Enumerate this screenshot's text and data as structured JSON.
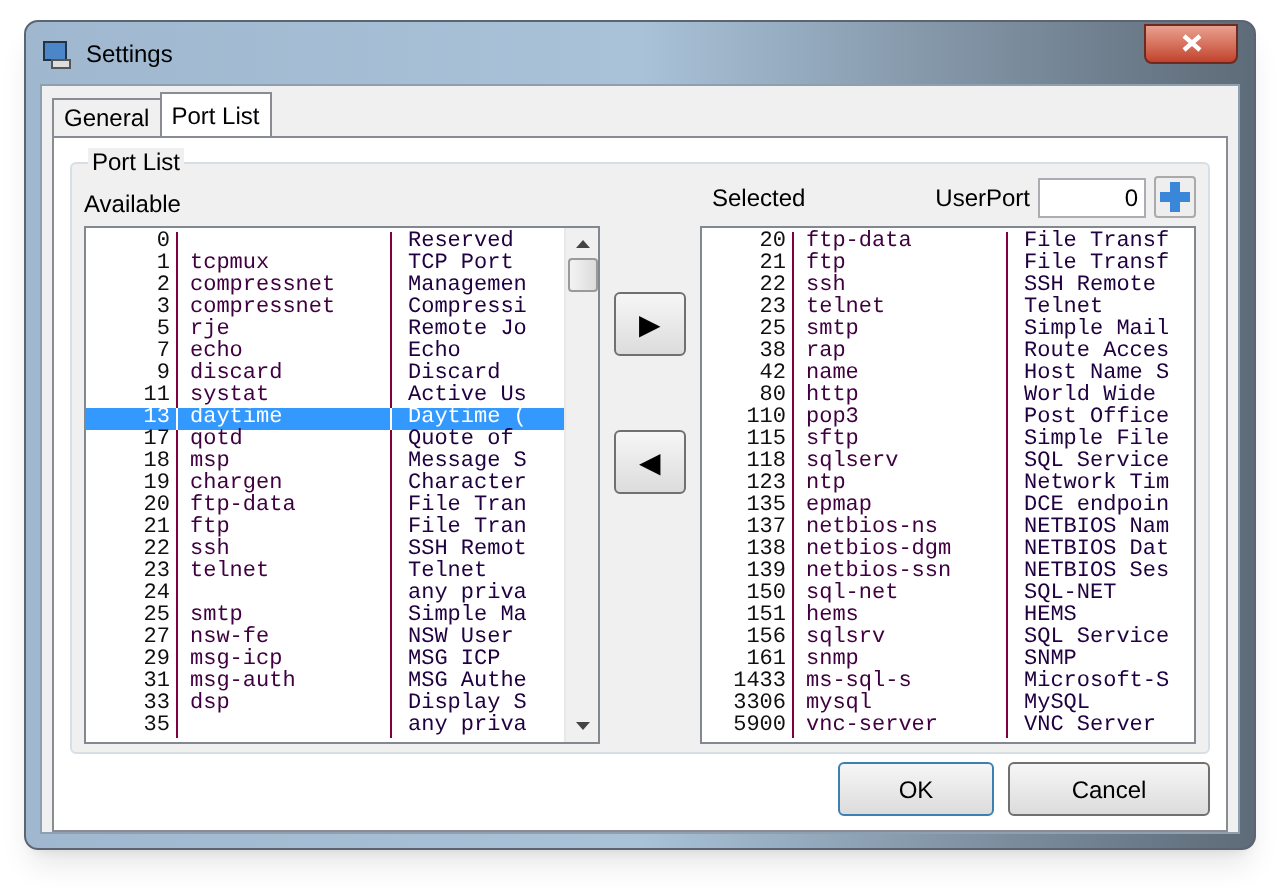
{
  "window": {
    "title": "Settings"
  },
  "tabs": [
    {
      "label": "General",
      "selected": false
    },
    {
      "label": "Port List",
      "selected": true
    }
  ],
  "group": {
    "title": "Port List"
  },
  "available": {
    "label": "Available",
    "rows": [
      {
        "port": "0",
        "name": "",
        "description": "Reserved",
        "selected": false
      },
      {
        "port": "1",
        "name": "tcpmux",
        "description": "TCP Port",
        "selected": false
      },
      {
        "port": "2",
        "name": "compressnet",
        "description": "Managemen",
        "selected": false
      },
      {
        "port": "3",
        "name": "compressnet",
        "description": "Compressi",
        "selected": false
      },
      {
        "port": "5",
        "name": "rje",
        "description": "Remote Jo",
        "selected": false
      },
      {
        "port": "7",
        "name": "echo",
        "description": "Echo",
        "selected": false
      },
      {
        "port": "9",
        "name": "discard",
        "description": "Discard",
        "selected": false
      },
      {
        "port": "11",
        "name": "systat",
        "description": "Active Us",
        "selected": false
      },
      {
        "port": "13",
        "name": "daytime",
        "description": "Daytime (",
        "selected": true
      },
      {
        "port": "17",
        "name": "qotd",
        "description": "Quote of",
        "selected": false
      },
      {
        "port": "18",
        "name": "msp",
        "description": "Message S",
        "selected": false
      },
      {
        "port": "19",
        "name": "chargen",
        "description": "Character",
        "selected": false
      },
      {
        "port": "20",
        "name": "ftp-data",
        "description": "File Tran",
        "selected": false
      },
      {
        "port": "21",
        "name": "ftp",
        "description": "File Tran",
        "selected": false
      },
      {
        "port": "22",
        "name": "ssh",
        "description": "SSH Remot",
        "selected": false
      },
      {
        "port": "23",
        "name": "telnet",
        "description": "Telnet",
        "selected": false
      },
      {
        "port": "24",
        "name": "",
        "description": "any priva",
        "selected": false
      },
      {
        "port": "25",
        "name": "smtp",
        "description": "Simple Ma",
        "selected": false
      },
      {
        "port": "27",
        "name": "nsw-fe",
        "description": "NSW User",
        "selected": false
      },
      {
        "port": "29",
        "name": "msg-icp",
        "description": "MSG ICP",
        "selected": false
      },
      {
        "port": "31",
        "name": "msg-auth",
        "description": "MSG Authe",
        "selected": false
      },
      {
        "port": "33",
        "name": "dsp",
        "description": "Display S",
        "selected": false
      },
      {
        "port": "35",
        "name": "",
        "description": "any priva",
        "selected": false
      }
    ]
  },
  "move_buttons": [
    "▶",
    "◀"
  ],
  "selected_list": {
    "label": "Selected",
    "rows": [
      {
        "port": "20",
        "name": "ftp-data",
        "description": "File Transf",
        "selected": false
      },
      {
        "port": "21",
        "name": "ftp",
        "description": "File Transf",
        "selected": false
      },
      {
        "port": "22",
        "name": "ssh",
        "description": "SSH Remote",
        "selected": false
      },
      {
        "port": "23",
        "name": "telnet",
        "description": "Telnet",
        "selected": false
      },
      {
        "port": "25",
        "name": "smtp",
        "description": "Simple Mail",
        "selected": false
      },
      {
        "port": "38",
        "name": "rap",
        "description": "Route Acces",
        "selected": false
      },
      {
        "port": "42",
        "name": "name",
        "description": "Host Name S",
        "selected": false
      },
      {
        "port": "80",
        "name": "http",
        "description": "World Wide",
        "selected": false
      },
      {
        "port": "110",
        "name": "pop3",
        "description": "Post Office",
        "selected": false
      },
      {
        "port": "115",
        "name": "sftp",
        "description": "Simple File",
        "selected": false
      },
      {
        "port": "118",
        "name": "sqlserv",
        "description": "SQL Service",
        "selected": false
      },
      {
        "port": "123",
        "name": "ntp",
        "description": "Network Tim",
        "selected": false
      },
      {
        "port": "135",
        "name": "epmap",
        "description": "DCE endpoin",
        "selected": false
      },
      {
        "port": "137",
        "name": "netbios-ns",
        "description": "NETBIOS Nam",
        "selected": false
      },
      {
        "port": "138",
        "name": "netbios-dgm",
        "description": "NETBIOS Dat",
        "selected": false
      },
      {
        "port": "139",
        "name": "netbios-ssn",
        "description": "NETBIOS Ses",
        "selected": false
      },
      {
        "port": "150",
        "name": "sql-net",
        "description": "SQL-NET",
        "selected": false
      },
      {
        "port": "151",
        "name": "hems",
        "description": "HEMS",
        "selected": false
      },
      {
        "port": "156",
        "name": "sqlsrv",
        "description": "SQL Service",
        "selected": false
      },
      {
        "port": "161",
        "name": "snmp",
        "description": "SNMP",
        "selected": false
      },
      {
        "port": "1433",
        "name": "ms-sql-s",
        "description": "Microsoft-S",
        "selected": false
      },
      {
        "port": "3306",
        "name": "mysql",
        "description": "MySQL",
        "selected": false
      },
      {
        "port": "5900",
        "name": "vnc-server",
        "description": "VNC Server",
        "selected": false
      }
    ]
  },
  "user_port": {
    "label": "UserPort",
    "value": "0"
  },
  "buttons": [
    "OK",
    "Cancel"
  ]
}
